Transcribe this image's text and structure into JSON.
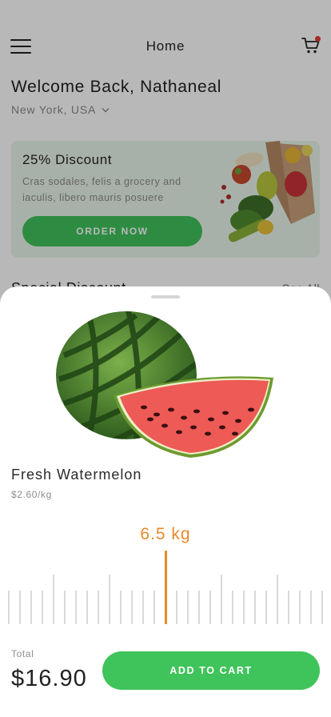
{
  "header": {
    "title": "Home",
    "menu_icon": "hamburger-menu-icon",
    "cart_icon": "shopping-cart-icon",
    "cart_badge_color": "#e53935"
  },
  "greeting": {
    "welcome": "Welcome Back, Nathaneal",
    "location": "New York, USA",
    "location_icon": "chevron-down-icon"
  },
  "promo": {
    "title": "25% Discount",
    "description": "Cras sodales, felis a grocery and iaculis, libero mauris posuere",
    "button_label": "ORDER NOW",
    "image": "grocery-bag-illustration"
  },
  "section": {
    "title": "Special Discount",
    "see_all": "See All"
  },
  "product": {
    "name": "Fresh Watermelon",
    "price": "$2.60/kg",
    "image": "watermelon-illustration"
  },
  "weight": {
    "value": "6.5 kg",
    "current_kg": 6.5,
    "step_kg": 0.1
  },
  "checkout": {
    "total_label": "Total",
    "total_value": "$16.90",
    "add_button_label": "ADD TO CART"
  },
  "colors": {
    "accent_green": "#3fc35b",
    "accent_orange": "#e8892a",
    "promo_background": "#e9f6ea"
  }
}
